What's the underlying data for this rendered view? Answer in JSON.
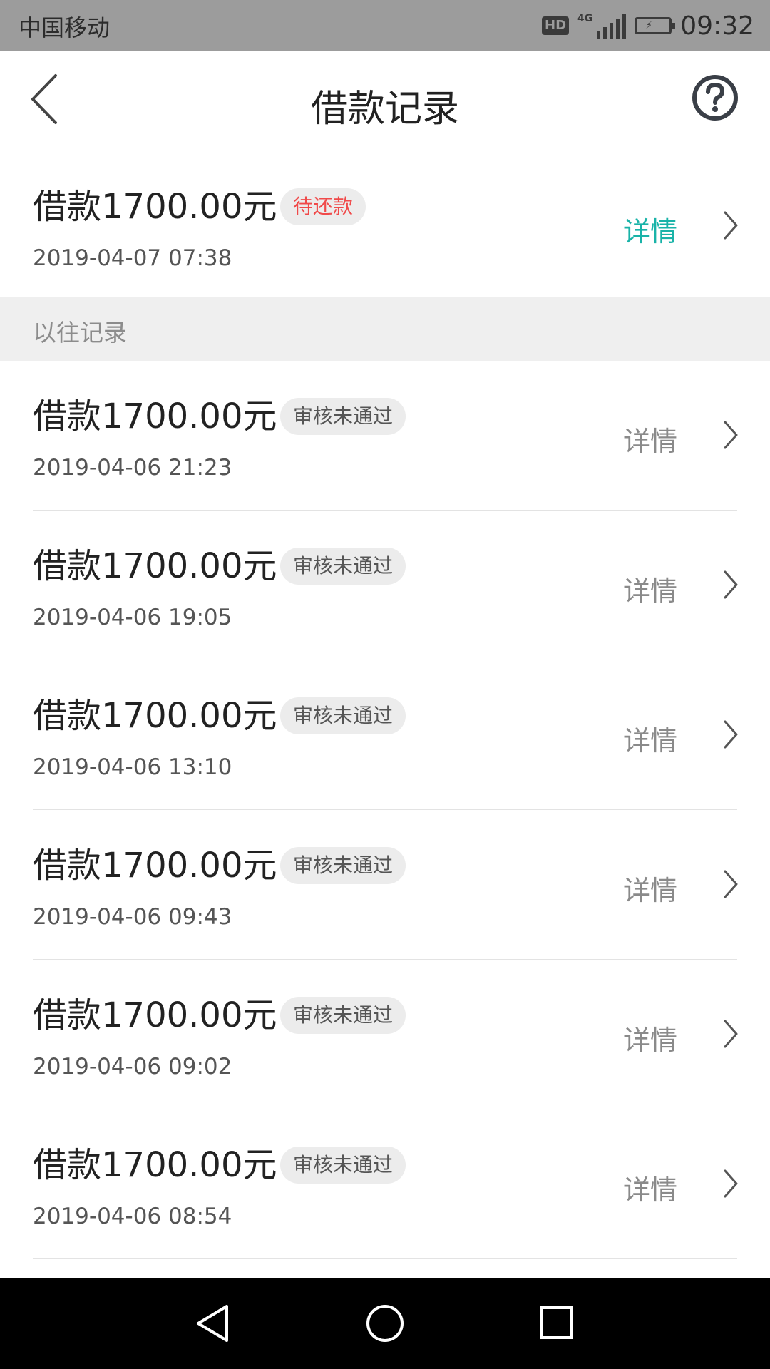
{
  "status_bar": {
    "carrier": "中国移动",
    "hd": "HD",
    "network": "4G",
    "time": "09:32"
  },
  "header": {
    "title": "借款记录"
  },
  "current": {
    "amount": "借款1700.00元",
    "status": "待还款",
    "date": "2019-04-07 07:38",
    "detail": "详情"
  },
  "section": {
    "label": "以往记录"
  },
  "history": [
    {
      "amount": "借款1700.00元",
      "status": "审核未通过",
      "date": "2019-04-06 21:23",
      "detail": "详情"
    },
    {
      "amount": "借款1700.00元",
      "status": "审核未通过",
      "date": "2019-04-06 19:05",
      "detail": "详情"
    },
    {
      "amount": "借款1700.00元",
      "status": "审核未通过",
      "date": "2019-04-06 13:10",
      "detail": "详情"
    },
    {
      "amount": "借款1700.00元",
      "status": "审核未通过",
      "date": "2019-04-06 09:43",
      "detail": "详情"
    },
    {
      "amount": "借款1700.00元",
      "status": "审核未通过",
      "date": "2019-04-06 09:02",
      "detail": "详情"
    },
    {
      "amount": "借款1700.00元",
      "status": "审核未通过",
      "date": "2019-04-06 08:54",
      "detail": "详情"
    }
  ],
  "colors": {
    "accent": "#19b3a8",
    "pending": "#f04a4a",
    "status_bar": "#9c9c9c"
  },
  "icons": {
    "back": "back-arrow-icon",
    "help": "question-circle-icon",
    "chevron": "chevron-right-icon",
    "nav_back": "triangle-back-icon",
    "nav_home": "circle-home-icon",
    "nav_recent": "square-recents-icon"
  }
}
